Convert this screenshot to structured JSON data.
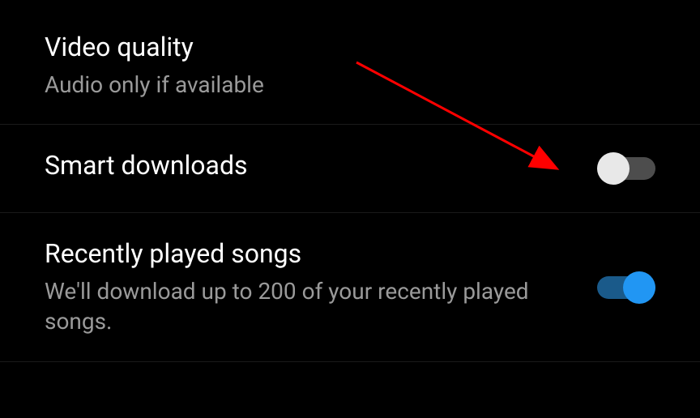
{
  "settings": [
    {
      "title": "Video quality",
      "subtitle": "Audio only if available",
      "hasToggle": false
    },
    {
      "title": "Smart downloads",
      "subtitle": "",
      "hasToggle": true,
      "toggleState": "off"
    },
    {
      "title": "Recently played songs",
      "subtitle": "We'll download up to 200 of your recently played songs.",
      "hasToggle": true,
      "toggleState": "on"
    }
  ],
  "annotation": {
    "arrowColor": "#ff0000"
  }
}
